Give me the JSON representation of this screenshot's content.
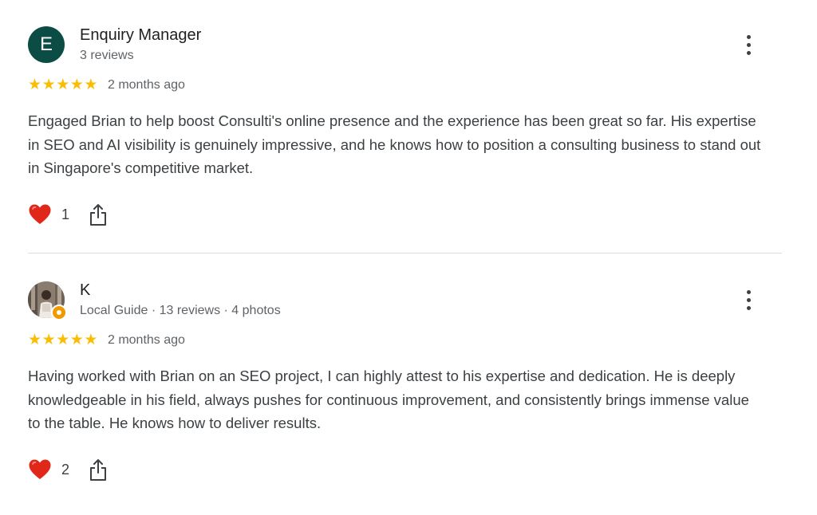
{
  "reviews": [
    {
      "avatar_letter": "E",
      "avatar_color": "#0b4d45",
      "name": "Enquiry Manager",
      "meta": "3 reviews",
      "stars": "★★★★★",
      "rating": 5,
      "date": "2 months ago",
      "text": "Engaged Brian to help boost Consulti's online presence and the experience has been great so far. His expertise in SEO and AI visibility is genuinely impressive, and he knows how to position a consulting business to stand out in Singapore's competitive market.",
      "likes": "1"
    },
    {
      "avatar_type": "photo",
      "name": "K",
      "meta": "Local Guide · 13 reviews · 4 photos",
      "stars": "★★★★★",
      "rating": 5,
      "date": "2 months ago",
      "text": "Having worked with Brian on an SEO project, I can highly attest to his expertise and dedication. He is deeply knowledgeable in his field, always pushes for continuous improvement, and consistently brings immense value to the table. He knows how to deliver results.",
      "likes": "2"
    }
  ],
  "icons": {
    "more": "more-vert-icon",
    "like": "heart-icon",
    "share": "share-icon",
    "star": "star-icon"
  },
  "colors": {
    "star": "#fbbc04",
    "heart": "#e0271a",
    "guide_badge": "#f29900"
  }
}
